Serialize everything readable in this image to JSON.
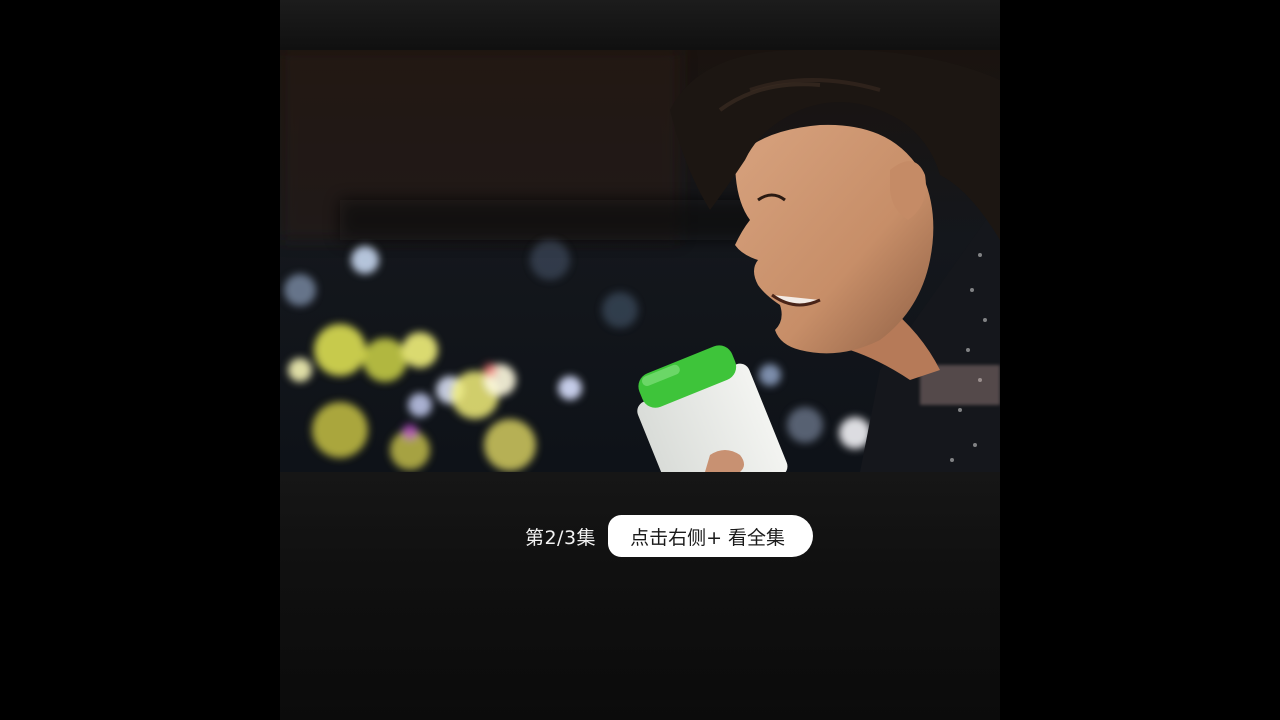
{
  "video": {
    "scene": "video-frame-still"
  },
  "episode": {
    "label": "第2/3集"
  },
  "cta": {
    "label": "点击右侧+ 看全集"
  },
  "colors": {
    "background": "#000000",
    "panel": "#121212",
    "button_bg": "#ffffff",
    "button_text": "#1a1a1a",
    "bottle_cap": "#3ec43a"
  }
}
